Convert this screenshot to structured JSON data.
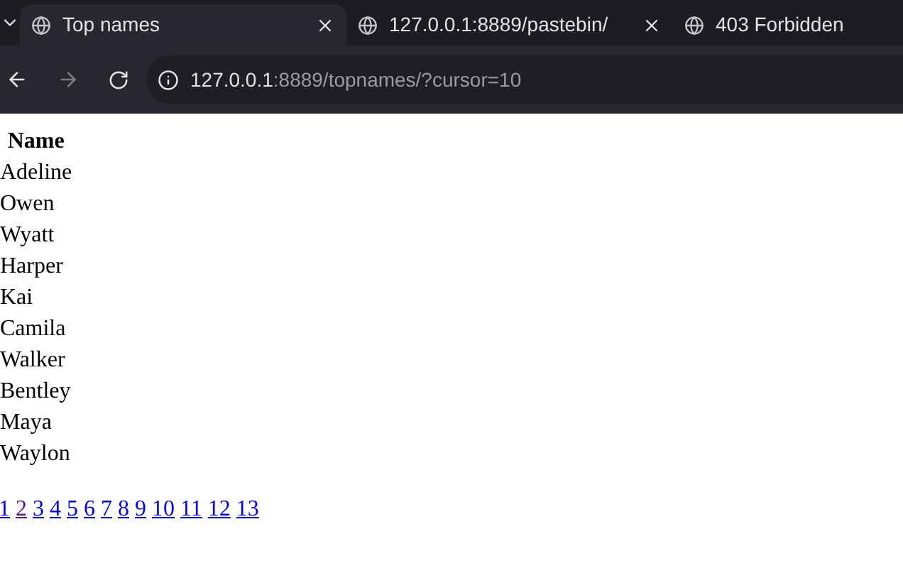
{
  "tabs": [
    {
      "title": "Top names",
      "selected": true
    },
    {
      "title": "127.0.0.1:8889/pastebin/",
      "selected": false
    },
    {
      "title": "403 Forbidden",
      "selected": false
    }
  ],
  "address_bar": {
    "host": "127.0.0.1",
    "rest": ":8889/topnames/?cursor=10"
  },
  "table": {
    "columns": [
      "Name"
    ],
    "rows": [
      "Adeline",
      "Owen",
      "Wyatt",
      "Harper",
      "Kai",
      "Camila",
      "Walker",
      "Bentley",
      "Maya",
      "Waylon"
    ]
  },
  "pages": [
    {
      "label": "1",
      "visited": false
    },
    {
      "label": "2",
      "visited": true
    },
    {
      "label": "3",
      "visited": false
    },
    {
      "label": "4",
      "visited": false
    },
    {
      "label": "5",
      "visited": false
    },
    {
      "label": "6",
      "visited": false
    },
    {
      "label": "7",
      "visited": false
    },
    {
      "label": "8",
      "visited": false
    },
    {
      "label": "9",
      "visited": false
    },
    {
      "label": "10",
      "visited": false
    },
    {
      "label": "11",
      "visited": false
    },
    {
      "label": "12",
      "visited": false
    },
    {
      "label": "13",
      "visited": false
    }
  ]
}
